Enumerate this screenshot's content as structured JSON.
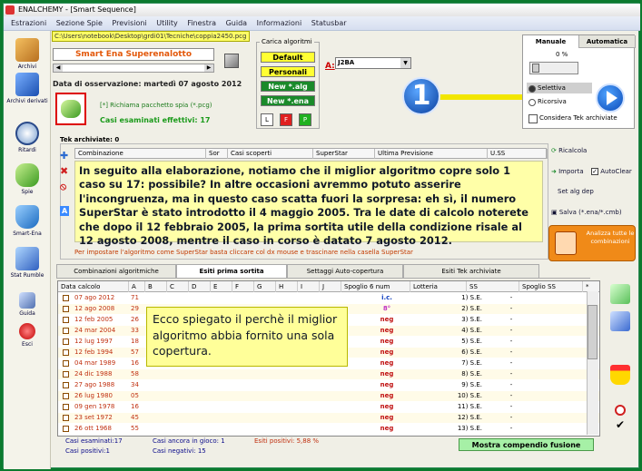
{
  "window": {
    "title": "ENALCHEMY - [Smart Sequence]"
  },
  "menu": [
    "Estrazioni",
    "Sezione Spie",
    "Previsioni",
    "Utility",
    "Finestra",
    "Guida",
    "Informazioni",
    "Statusbar"
  ],
  "sidebar": [
    {
      "label": "Archivi"
    },
    {
      "label": "Archivi derivati"
    },
    {
      "label": "Ritardi"
    },
    {
      "label": "Spie"
    },
    {
      "label": "Smart-Ena"
    },
    {
      "label": "Stat Rumble"
    },
    {
      "label": "Guida"
    },
    {
      "label": "Esci"
    }
  ],
  "path": "C:\\Users\\notebook\\Desktop\\grdi01\\Tecniche\\coppia2450.pcg",
  "game": "Smart Ena Superenalotto",
  "obs_date": "Data di osservazione:  martedì 07 agosto 2012",
  "spia_link": "[*] Richiama pacchetto spia (*.pcg)",
  "casi_effettivi": "Casi esaminati effettivi: 17",
  "carica": {
    "label": "Carica algoritmi",
    "buttons": [
      "Default",
      "Personali",
      "New *.alg",
      "New *.ena"
    ],
    "small": [
      "L",
      "F",
      "P"
    ]
  },
  "algo": {
    "label": "A:",
    "value": "J2BA"
  },
  "badge_number": "1",
  "rpanel": {
    "tabs": [
      "Manuale",
      "Automatica"
    ],
    "percent": "0 %",
    "options": [
      "Selettiva",
      "Ricorsiva"
    ],
    "checkbox": "Considera Tek archiviate"
  },
  "tek": {
    "label": "Tek archiviate: 0",
    "columns": [
      "Combinazione",
      "Sor",
      "Casi scoperti",
      "SuperStar",
      "Ultima Previsione",
      "U.SS"
    ]
  },
  "note": "In seguito alla elaborazione, notiamo che il miglior algoritmo copre solo 1 caso su 17: possibile? In altre occasioni avremmo potuto asserire l'incongruenza, ma in questo caso scatta fuori la sorpresa: eh sì, il numero SuperStar è stato introdotto il 4 maggio 2005. Tra le date di calcolo noterete che dopo il 12 febbraio 2005, la prima sortita utile della condizione risale al 12 agosto 2008, mentre il caso in corso è datato 7 agosto 2012.",
  "hint": "Per impostare l'algoritmo come SuperStar basta cliccare col dx mouse e trascinare nella casella SuperStar",
  "actions": {
    "ricalcola": "Ricalcola",
    "importa": "Importa",
    "autoclear": "AutoClear",
    "set_alg": "Set alg dep",
    "salva": "Salva (*.ena/*.cmb)",
    "analizza": "Analizza tutte le combinazioni"
  },
  "tabs": [
    "Combinazioni algoritmiche",
    "Esiti prima sortita",
    "Settaggi Auto-copertura",
    "Esiti Tek archiviate"
  ],
  "grid": {
    "headers": [
      "Data calcolo",
      "A",
      "B",
      "C",
      "D",
      "E",
      "F",
      "G",
      "H",
      "I",
      "J",
      "Spoglio 6 num",
      "Lotteria",
      "SS",
      "Spoglio SS",
      "*"
    ],
    "rows": [
      {
        "date": "07 ago 2012",
        "a": "71",
        "spoglio": "i.c.",
        "lot": "1) S.E.",
        "ss": "-",
        "spc": "#1040c0"
      },
      {
        "date": "12 ago 2008",
        "a": "29",
        "spoglio": "8°",
        "lot": "2) S.E.",
        "ss": "-",
        "spc": "#c030c0"
      },
      {
        "date": "12 feb 2005",
        "a": "26",
        "spoglio": "neg",
        "lot": "3) S.E.",
        "ss": "-",
        "spc": "#c01010"
      },
      {
        "date": "24 mar 2004",
        "a": "33",
        "spoglio": "neg",
        "lot": "4) S.E.",
        "ss": "-",
        "spc": "#c01010"
      },
      {
        "date": "12 lug 1997",
        "a": "18",
        "spoglio": "neg",
        "lot": "5) S.E.",
        "ss": "-",
        "spc": "#c01010"
      },
      {
        "date": "12 feb 1994",
        "a": "57",
        "spoglio": "neg",
        "lot": "6) S.E.",
        "ss": "-",
        "spc": "#c01010"
      },
      {
        "date": "04 mar 1989",
        "a": "16",
        "spoglio": "neg",
        "lot": "7) S.E.",
        "ss": "-",
        "spc": "#c01010"
      },
      {
        "date": "24 dic 1988",
        "a": "58",
        "spoglio": "neg",
        "lot": "8) S.E.",
        "ss": "-",
        "spc": "#c01010"
      },
      {
        "date": "27 ago 1988",
        "a": "34",
        "spoglio": "neg",
        "lot": "9) S.E.",
        "ss": "-",
        "spc": "#c01010"
      },
      {
        "date": "26 lug 1980",
        "a": "05",
        "spoglio": "neg",
        "lot": "10) S.E.",
        "ss": "-",
        "spc": "#c01010"
      },
      {
        "date": "09 gen 1978",
        "a": "16",
        "spoglio": "neg",
        "lot": "11) S.E.",
        "ss": "-",
        "spc": "#c01010"
      },
      {
        "date": "23 set 1972",
        "a": "45",
        "spoglio": "neg",
        "lot": "12) S.E.",
        "ss": "-",
        "spc": "#c01010"
      },
      {
        "date": "26 ott 1968",
        "a": "55",
        "spoglio": "neg",
        "lot": "13) S.E.",
        "ss": "-",
        "spc": "#c01010"
      }
    ]
  },
  "callout": "Ecco spiegato il perchè il miglior algoritmo abbia fornito una sola copertura.",
  "footer": {
    "casi_esaminati": "Casi esaminati:17",
    "casi_positivi": "Casi positivi:1",
    "ancora": "Casi ancora in gioco: 1",
    "negativi": "Casi negativi: 15",
    "esiti": "Esiti positivi: 5,88 %"
  },
  "mostra": "Mostra compendio fusione"
}
